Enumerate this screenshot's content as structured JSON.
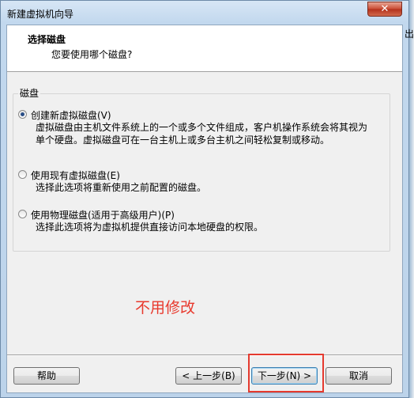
{
  "window": {
    "title": "新建虚拟机向导",
    "close_glyph": "✕"
  },
  "header": {
    "title": "选择磁盘",
    "subtitle": "您要使用哪个磁盘?"
  },
  "group": {
    "label": "磁盘",
    "options": [
      {
        "label": "创建新虚拟磁盘(V)",
        "description": "虚拟磁盘由主机文件系统上的一个或多个文件组成，客户机操作系统会将其视为单个硬盘。虚拟磁盘可在一台主机上或多台主机之间轻松复制或移动。",
        "selected": true
      },
      {
        "label": "使用现有虚拟磁盘(E)",
        "description": "选择此选项将重新使用之前配置的磁盘。",
        "selected": false
      },
      {
        "label": "使用物理磁盘(适用于高级用户)(P)",
        "description": "选择此选项将为虚拟机提供直接访问本地硬盘的权限。",
        "selected": false
      }
    ]
  },
  "annotation": {
    "text": "不用修改",
    "color": "#e8392d"
  },
  "buttons": {
    "help": "帮助",
    "back": "< 上一步(B)",
    "next": "下一步(N) >",
    "cancel": "取消"
  },
  "edge": {
    "glyph": "出"
  }
}
